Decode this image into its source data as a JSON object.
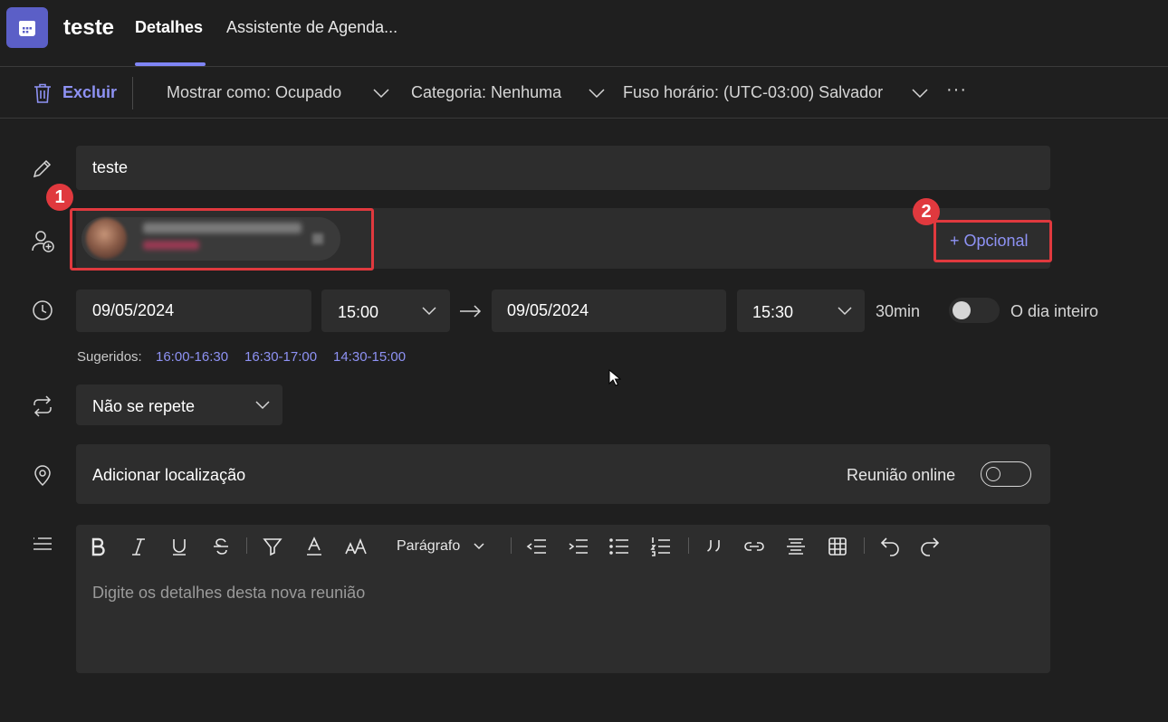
{
  "header": {
    "meeting_title": "teste",
    "tabs": [
      {
        "label": "Detalhes",
        "active": true
      },
      {
        "label": "Assistente de Agenda..."
      }
    ]
  },
  "toolbar": {
    "delete_label": "Excluir",
    "show_as": "Mostrar como: Ocupado",
    "category": "Categoria: Nenhuma",
    "timezone": "Fuso horário: (UTC-03:00) Salvador",
    "more_label": "···"
  },
  "form": {
    "title_value": "teste",
    "optional_label": "+ Opcional",
    "annotations": {
      "badge1": "1",
      "badge2": "2"
    },
    "start_date": "09/05/2024",
    "start_time": "15:00",
    "end_date": "09/05/2024",
    "end_time": "15:30",
    "duration": "30min",
    "all_day_label": "O dia inteiro",
    "suggested_label": "Sugeridos:",
    "suggested_slots": [
      "16:00-16:30",
      "16:30-17:00",
      "14:30-15:00"
    ],
    "repeat_value": "Não se repete",
    "location_placeholder": "Adicionar localização",
    "online_meeting_label": "Reunião online",
    "paragraph_style": "Parágrafo",
    "details_placeholder": "Digite os detalhes desta nova reunião"
  },
  "colors": {
    "accent": "#7f85f5",
    "annotation_red": "#e0393e",
    "background": "#1f1f1f",
    "field": "#2d2d2d"
  }
}
